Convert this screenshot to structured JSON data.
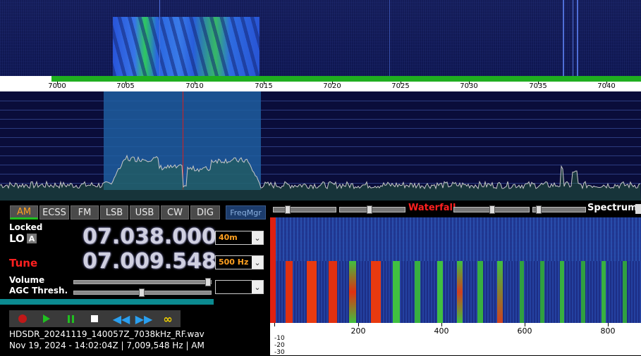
{
  "frequency_scale": {
    "labels": [
      "7000",
      "7005",
      "7010",
      "7015",
      "7020",
      "7025",
      "7030",
      "7035",
      "7040"
    ]
  },
  "modes": [
    {
      "label": "AM",
      "active": true
    },
    {
      "label": "ECSS",
      "active": false
    },
    {
      "label": "FM",
      "active": false
    },
    {
      "label": "LSB",
      "active": false
    },
    {
      "label": "USB",
      "active": false
    },
    {
      "label": "CW",
      "active": false
    },
    {
      "label": "DIG",
      "active": false
    }
  ],
  "freqmgr_label": "FreqMgr",
  "lo": {
    "status_label": "Locked",
    "label": "LO",
    "badge": "A",
    "frequency": "07.038.000",
    "band": "40m"
  },
  "tune": {
    "label": "Tune",
    "frequency": "07.009.548",
    "step": "500 Hz"
  },
  "volume_label": "Volume",
  "agc_label": "AGC Thresh.",
  "agc_select_value": "",
  "transport": {
    "record_icon": "record-icon",
    "play_icon": "play-icon",
    "pause_icon": "pause-icon",
    "stop_icon": "stop-icon",
    "rewind_icon": "rewind-icon",
    "forward_icon": "fast-forward-icon",
    "loop_icon": "loop-icon"
  },
  "file": {
    "name": "HDSDR_20241119_140057Z_7038kHz_RF.wav",
    "info": "Nov 19, 2024 - 14:02:04Z | 7,009,548 Hz | AM"
  },
  "audio_panel": {
    "waterfall_label": "Waterfall",
    "spectrum_label": "Spectrum",
    "scale_labels": [
      "200",
      "400",
      "600",
      "800"
    ],
    "db_labels": [
      "-10",
      "-20",
      "-30"
    ]
  },
  "colors": {
    "active_mode": "#ffa020",
    "tune_label": "#ff2020",
    "waterfall_label": "#ff2020",
    "passband": "#1e5ea0",
    "scale_bar": "#1fae1f"
  }
}
